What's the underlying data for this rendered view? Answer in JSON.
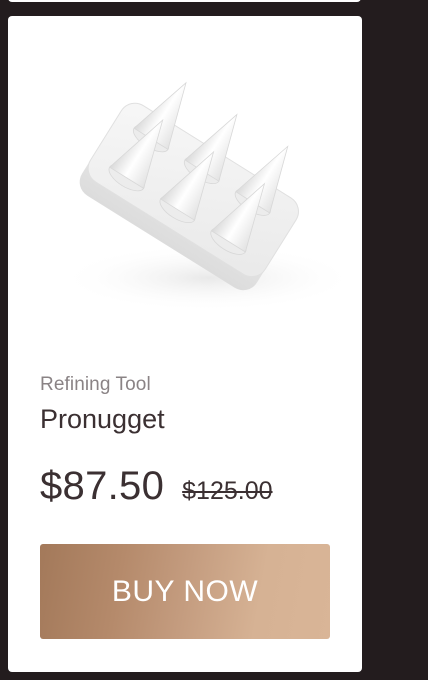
{
  "product": {
    "category": "Refining Tool",
    "name": "Pronugget",
    "price": "$87.50",
    "original_price": "$125.00",
    "image_alt": "white spiked refining tool"
  },
  "actions": {
    "buy_label": "BUY NOW"
  },
  "colors": {
    "background": "#231c1e",
    "card": "#ffffff",
    "text_dark": "#3b3032",
    "text_muted": "#8a8385",
    "button_gradient_start": "#a3795a",
    "button_gradient_end": "#d9b597"
  }
}
